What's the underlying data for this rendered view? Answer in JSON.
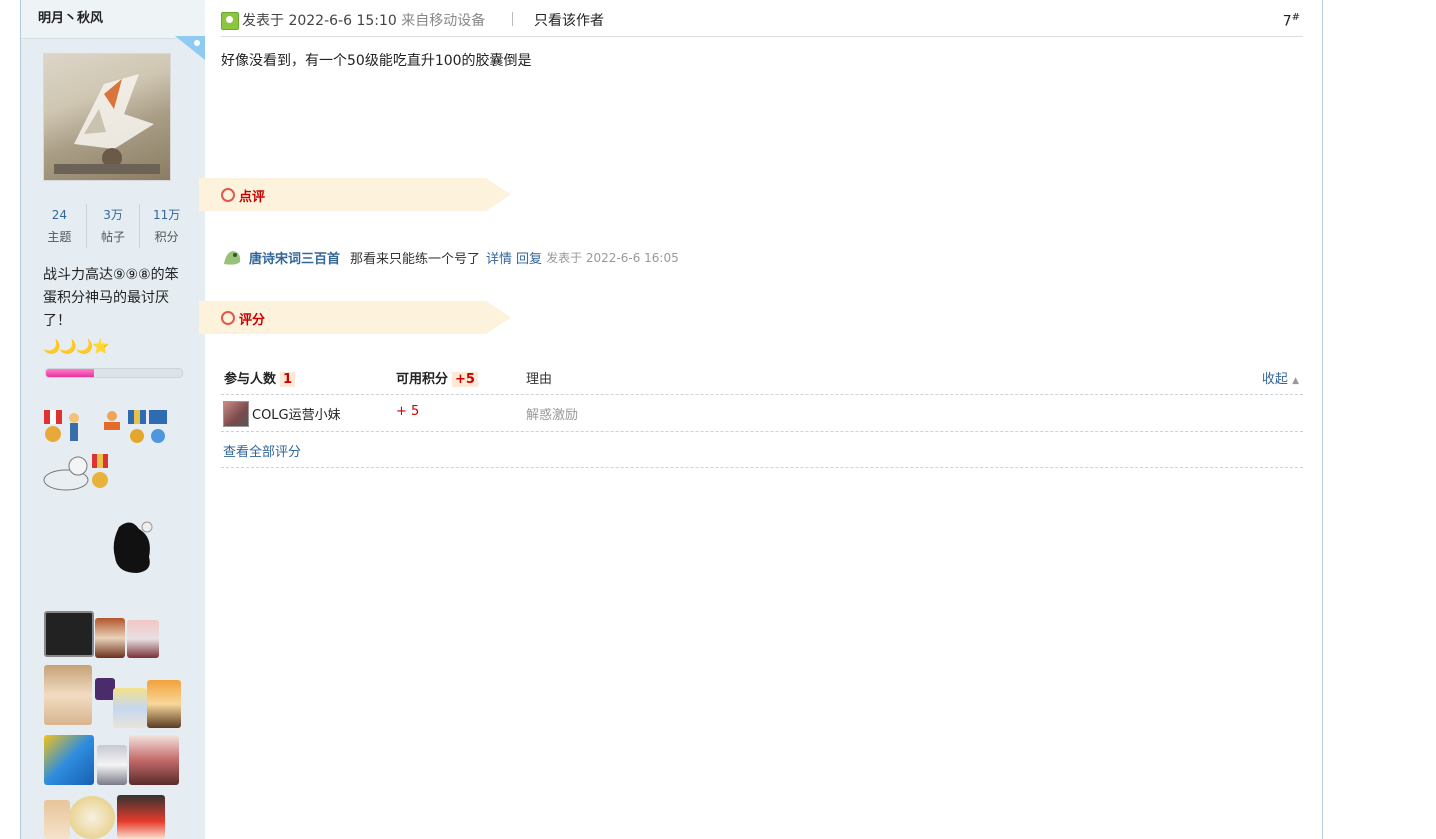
{
  "author": {
    "name": "明月丶秋风",
    "stats": [
      {
        "num": "24",
        "label": "主题"
      },
      {
        "num": "3万",
        "label": "帖子"
      },
      {
        "num": "11万",
        "label": "积分"
      }
    ],
    "signature": "战斗力高达⑨⑨⑧的笨蛋积分神马的最讨厌了！",
    "level_icons": "🌙🌙🌙⭐",
    "level_progress": 0.35
  },
  "post": {
    "time_prefix": "发表于 2022-6-6 15:10",
    "from": "来自移动设备",
    "only_author": "只看该作者",
    "floor": "7",
    "floor_mark": "#",
    "content": "好像没看到，有一个50级能吃直升100的胶囊倒是"
  },
  "comments_section": {
    "title": "点评",
    "items": [
      {
        "user": "唐诗宋词三百首",
        "text": "那看来只能练一个号了",
        "detail": "详情",
        "reply": "回复",
        "time": "发表于 2022-6-6 16:05"
      }
    ]
  },
  "rating_section": {
    "title": "评分",
    "head": {
      "participants_label": "参与人数",
      "participants_count": "1",
      "points_label": "可用积分",
      "points_value": "+5",
      "reason_label": "理由",
      "collapse": "收起"
    },
    "rows": [
      {
        "user": "COLG运营小妹",
        "score": "+ 5",
        "reason": "解惑激励"
      }
    ],
    "view_all": "查看全部评分"
  }
}
